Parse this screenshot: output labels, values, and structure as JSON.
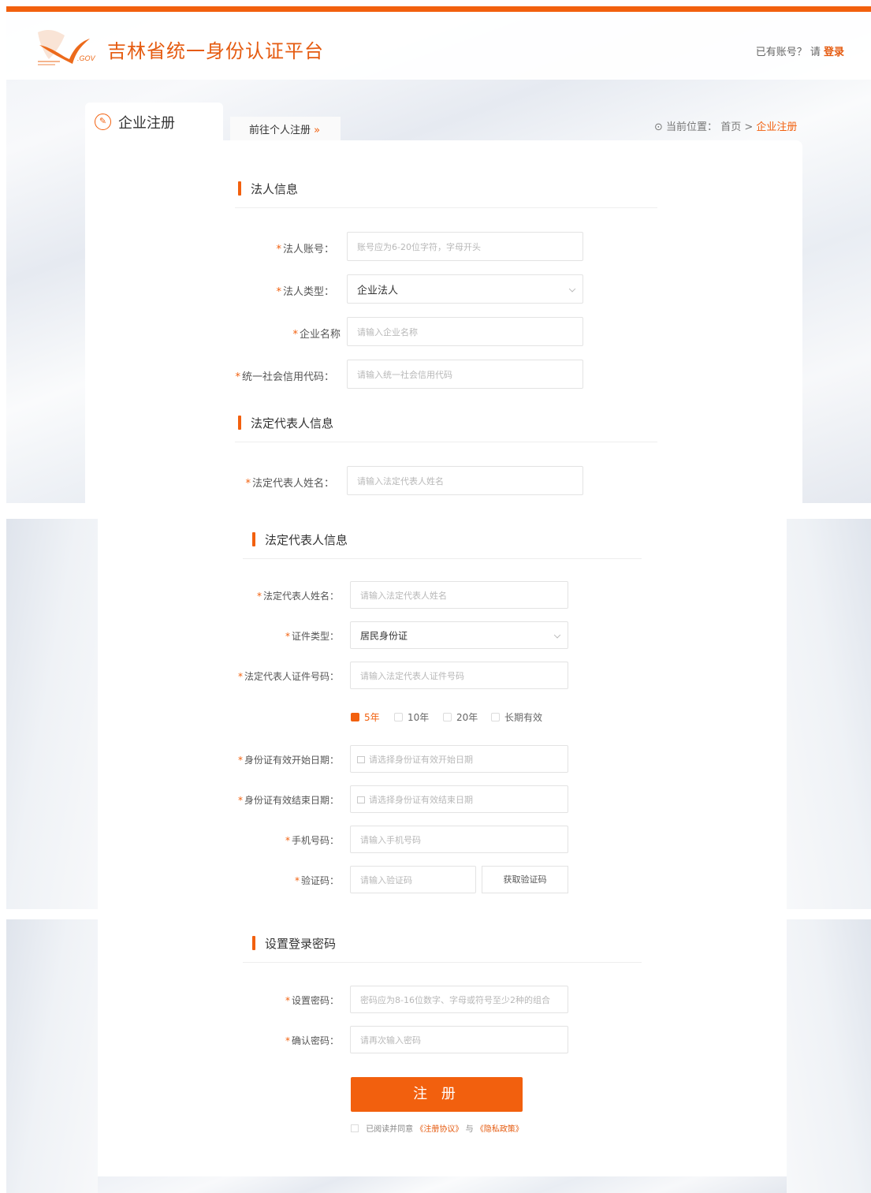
{
  "header": {
    "site_title": "吉林省统一身份认证平台",
    "logo_text": ".GOV",
    "login_hint": "已有账号？ 请",
    "login_link": "登录"
  },
  "tabs": {
    "active": "企业注册",
    "personal_link": "前往个人注册",
    "personal_arrow": "»"
  },
  "breadcrumb": {
    "prefix": "当前位置：",
    "home": "首页",
    "sep": ">",
    "current": "企业注册"
  },
  "legal_entity": {
    "title": "法人信息",
    "fields": [
      {
        "label": "法人账号：",
        "placeholder": "账号应为6-20位字符，字母开头"
      },
      {
        "label": "法人类型：",
        "value": "企业法人"
      },
      {
        "label": "企业名称",
        "placeholder": "请输入企业名称"
      },
      {
        "label": "统一社会信用代码：",
        "placeholder": "请输入统一社会信用代码"
      }
    ]
  },
  "representative_preview": {
    "title": "法定代表人信息",
    "name_label": "法定代表人姓名：",
    "name_placeholder": "请输入法定代表人姓名"
  },
  "representative": {
    "title": "法定代表人信息",
    "name_label": "法定代表人姓名：",
    "name_placeholder": "请输入法定代表人姓名",
    "id_type_label": "证件类型：",
    "id_type_value": "居民身份证",
    "id_number_label": "法定代表人证件号码：",
    "id_number_placeholder": "请输入法定代表人证件号码",
    "validity_options": [
      "5年",
      "10年",
      "20年",
      "长期有效"
    ],
    "validity_selected": "5年",
    "start_label": "身份证有效开始日期：",
    "start_placeholder": "请选择身份证有效开始日期",
    "end_label": "身份证有效结束日期：",
    "end_placeholder": "请选择身份证有效结束日期",
    "phone_label": "手机号码：",
    "phone_placeholder": "请输入手机号码",
    "code_label": "验证码：",
    "code_placeholder": "请输入验证码",
    "code_button": "获取验证码"
  },
  "password": {
    "title": "设置登录密码",
    "set_label": "设置密码：",
    "set_placeholder": "密码应为8-16位数字、字母或符号至少2种的组合",
    "confirm_label": "确认密码：",
    "confirm_placeholder": "请再次输入密码",
    "submit": "注 册",
    "agree_prefix": "已阅读并同意",
    "agreement": "《注册协议》",
    "and": "与",
    "privacy": "《隐私政策》"
  },
  "required_mark": "*",
  "colors": {
    "accent": "#f2600e",
    "title": "#e55b10"
  }
}
